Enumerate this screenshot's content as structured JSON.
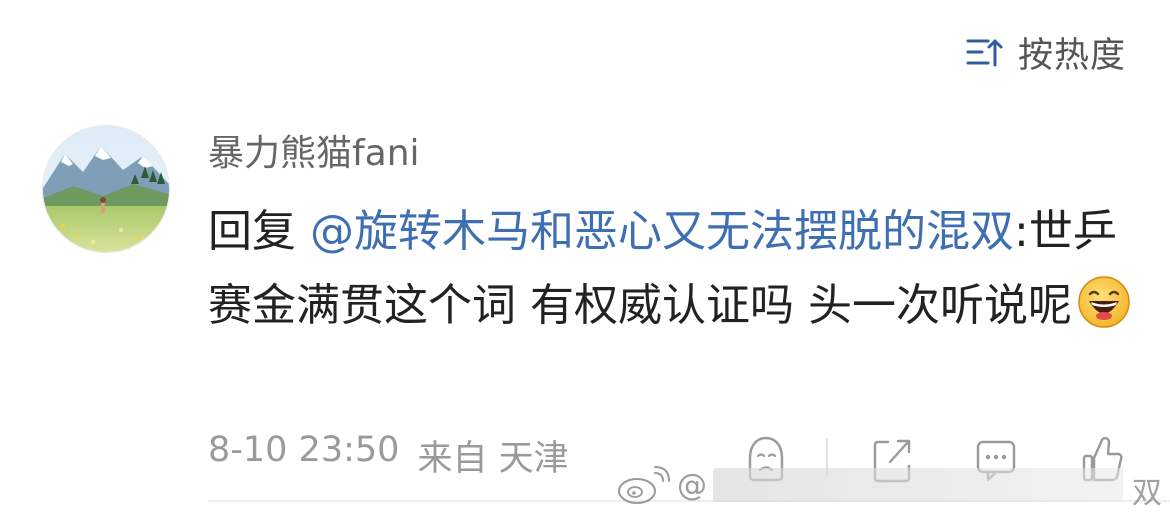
{
  "sort": {
    "label": "按热度",
    "icon": "sort-icon"
  },
  "comment": {
    "avatar": "avatar",
    "username": "暴力熊猫fani",
    "reply_prefix": "回复",
    "mention": "@旋转木马和恶心又无法摆脱的混双",
    "text": ":世乒赛金满贯这个词 有权威认证吗 头一次听说呢",
    "emoji": "laughing-emoji",
    "time": "8-10 23:50",
    "source": "来自 天津"
  },
  "actions": [
    {
      "name": "dislike-button",
      "icon": "sad-face-icon"
    },
    {
      "name": "share-button",
      "icon": "share-icon"
    },
    {
      "name": "comment-button",
      "icon": "comment-icon"
    },
    {
      "name": "like-button",
      "icon": "thumbs-up-icon"
    }
  ],
  "watermark": {
    "at": "@",
    "tail": "双"
  },
  "colors": {
    "mention": "#3f6fb3",
    "text": "#222222",
    "meta": "#9a9a9a",
    "icon": "#9a9a9a"
  }
}
